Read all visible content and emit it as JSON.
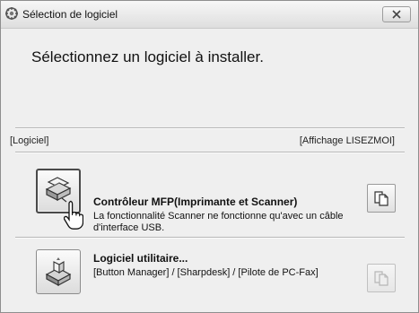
{
  "window": {
    "title": "Sélection de logiciel"
  },
  "heading": "Sélectionnez un logiciel à installer.",
  "tags": {
    "left": "[Logiciel]",
    "right": "[Affichage LISEZMOI]"
  },
  "items": [
    {
      "title": "Contrôleur MFP(Imprimante et Scanner)",
      "description": "La fonctionnalité Scanner ne fonctionne qu'avec un câble d'interface USB.",
      "icon": "printer-scanner-icon",
      "state": "pressed",
      "readme_enabled": true
    },
    {
      "title": "Logiciel utilitaire...",
      "description": "[Button Manager] / [Sharpdesk] / [Pilote de PC-Fax]",
      "icon": "utility-software-icon",
      "state": "normal",
      "readme_enabled": false
    }
  ],
  "icons": {
    "title": "setup-icon",
    "close": "close-icon",
    "readme": "readme-document-icon",
    "cursor": "mouse-cursor-icon"
  }
}
